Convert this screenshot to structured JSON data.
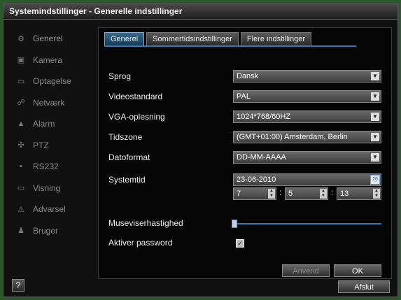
{
  "window": {
    "title": "Systemindstillinger - Generelle indstillinger"
  },
  "sidebar": {
    "items": [
      {
        "label": "Generel",
        "icon": "gear-icon"
      },
      {
        "label": "Kamera",
        "icon": "camera-icon"
      },
      {
        "label": "Optagelse",
        "icon": "record-icon"
      },
      {
        "label": "Netværk",
        "icon": "network-icon"
      },
      {
        "label": "Alarm",
        "icon": "alarm-icon"
      },
      {
        "label": "PTZ",
        "icon": "ptz-icon"
      },
      {
        "label": "RS232",
        "icon": "rs232-icon"
      },
      {
        "label": "Visning",
        "icon": "monitor-icon"
      },
      {
        "label": "Advarsel",
        "icon": "warning-icon"
      },
      {
        "label": "Bruger",
        "icon": "user-icon"
      }
    ]
  },
  "tabs": [
    {
      "label": "Generel"
    },
    {
      "label": "Sommertidsindstillinger"
    },
    {
      "label": "Flere indstillinger"
    }
  ],
  "form": {
    "language_label": "Sprog",
    "language_value": "Dansk",
    "video_label": "Videostandard",
    "video_value": "PAL",
    "vga_label": "VGA-oplesning",
    "vga_value": "1024*768/60HZ",
    "timezone_label": "Tidszone",
    "timezone_value": "(GMT+01:00) Amsterdam, Berlin",
    "dateformat_label": "Datoformat",
    "dateformat_value": "DD-MM-AAAA",
    "systemtime_label": "Systemtid",
    "date_value": "23-06-2010",
    "hour_value": "7",
    "minute_value": "5",
    "second_value": "13",
    "mouse_speed_label": "Museviserhastighed",
    "mouse_speed_level": 0.02,
    "password_label": "Aktiver password",
    "password_checked": true
  },
  "buttons": {
    "apply": "Anvend",
    "ok": "OK",
    "exit": "Afslut",
    "help": "?"
  },
  "colors": {
    "accent": "#3a78b0",
    "frame_bg": "#111111",
    "outer_bg": "#2b5a2a"
  }
}
